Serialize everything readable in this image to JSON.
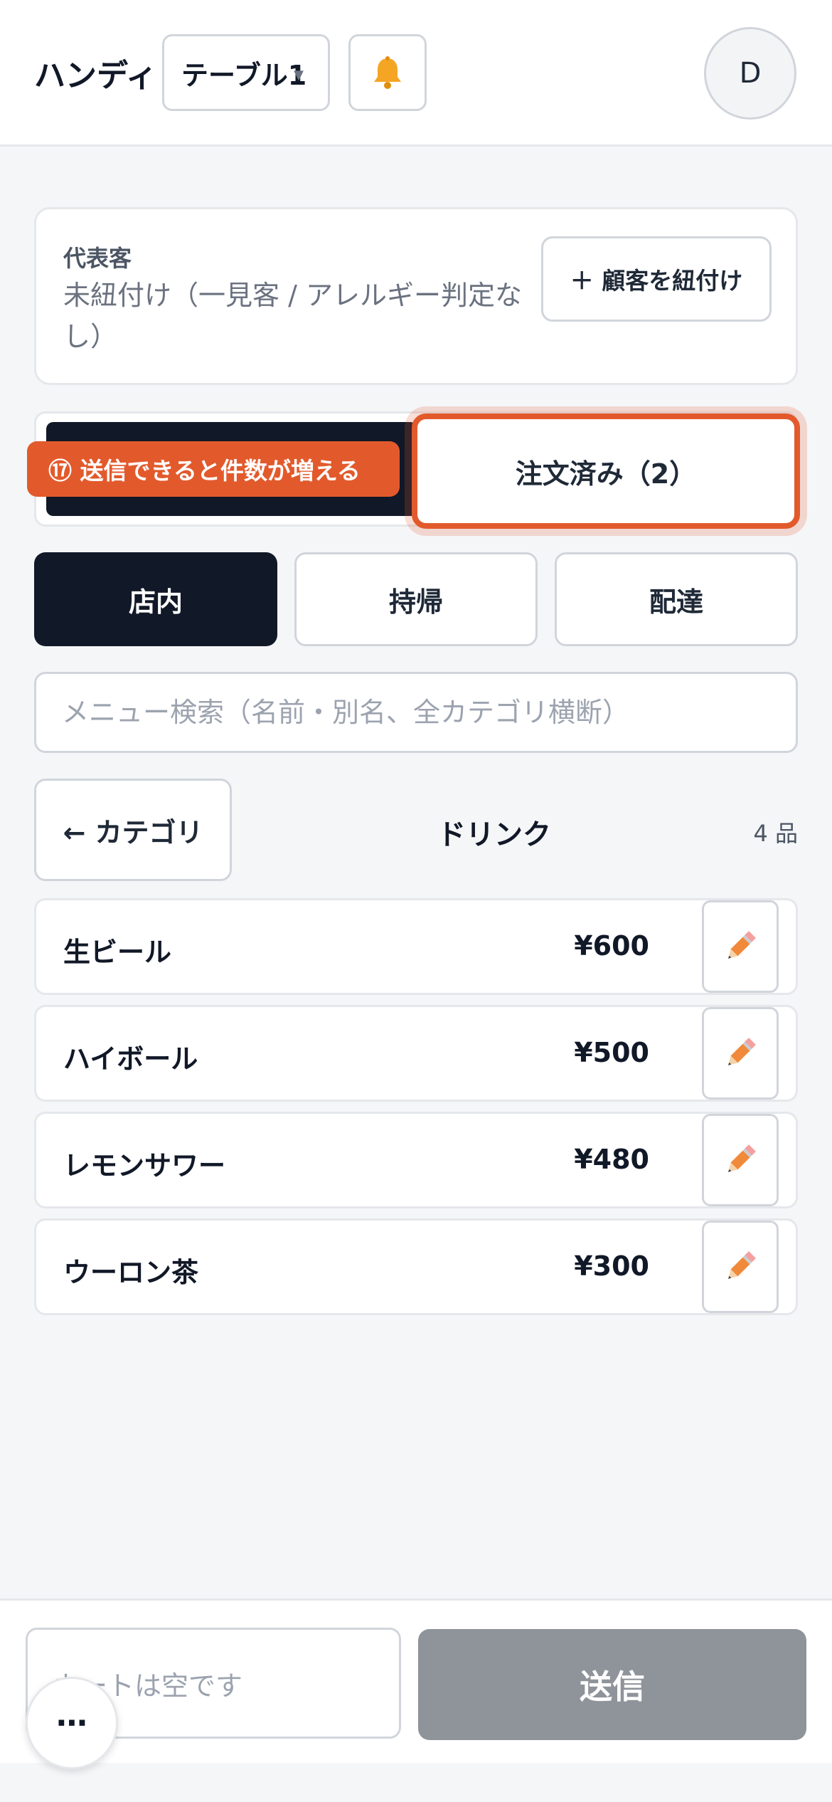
{
  "header": {
    "title": "ハンディ",
    "table_label": "テーブル1",
    "caret": "▼",
    "bell_icon": "bell-icon",
    "avatar_initial": "D"
  },
  "customer": {
    "caption": "代表客",
    "status": "未紐付け（一見客 / アレルギー判定なし）",
    "link_label": "＋ 顧客を紐付け"
  },
  "tabs": {
    "ordered_label": "注文済み（2）",
    "hint": "⑰ 送信できると件数が増える"
  },
  "modes": [
    "店内",
    "持帰",
    "配達"
  ],
  "search": {
    "placeholder": "メニュー検索（名前・別名、全カテゴリ横断）"
  },
  "category": {
    "back_label": "← カテゴリ",
    "title": "ドリンク",
    "count": "4 品"
  },
  "menu_items": [
    {
      "name": "生ビール",
      "price": "¥600"
    },
    {
      "name": "ハイボール",
      "price": "¥500"
    },
    {
      "name": "レモンサワー",
      "price": "¥480"
    },
    {
      "name": "ウーロン茶",
      "price": "¥300"
    }
  ],
  "footer": {
    "cart_text": "カートは空です",
    "send_label": "送信",
    "more_label": "⋯"
  },
  "colors": {
    "accent": "#e25a2c",
    "dark": "#111827",
    "disabled": "#8f939a"
  }
}
